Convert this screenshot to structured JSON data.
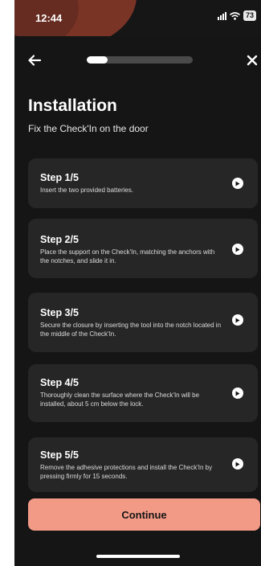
{
  "status_bar": {
    "time": "12:44",
    "battery": "73"
  },
  "header": {
    "progress": 0.2
  },
  "title": "Installation",
  "subtitle": "Fix the Check'In on the door",
  "steps": [
    {
      "title": "Step 1/5",
      "description": "Insert the two provided batteries."
    },
    {
      "title": "Step 2/5",
      "description": "Place the support on the Check'In, matching the anchors with the notches, and slide it in."
    },
    {
      "title": "Step 3/5",
      "description": "Secure the closure by inserting the tool into the notch located in the middle of the Check'In."
    },
    {
      "title": "Step 4/5",
      "description": "Thoroughly clean the surface where the Check'In will be installed, about 5 cm below the lock."
    },
    {
      "title": "Step 5/5",
      "description": "Remove the adhesive protections and install the Check'In by pressing firmly for 15 seconds."
    }
  ],
  "continue_label": "Continue",
  "colors": {
    "accent": "#f39a87",
    "background": "#151515",
    "card": "#262626",
    "status_accent": "#7a3426"
  }
}
